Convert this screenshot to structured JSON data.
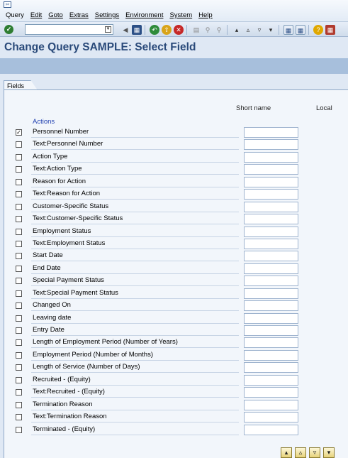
{
  "menubar": {
    "items": [
      "Query",
      "Edit",
      "Goto",
      "Extras",
      "Settings",
      "Environment",
      "System",
      "Help"
    ]
  },
  "toolbar": {
    "command_value": ""
  },
  "title": "Change Query SAMPLE: Select Field",
  "tab": {
    "label": "Fields"
  },
  "columns": {
    "short_name": "Short name",
    "local": "Local"
  },
  "group": {
    "label": "Actions"
  },
  "fields": [
    {
      "label": "Personnel Number",
      "checked": true
    },
    {
      "label": "Text:Personnel Number",
      "checked": false
    },
    {
      "label": "Action Type",
      "checked": false
    },
    {
      "label": "Text:Action Type",
      "checked": false
    },
    {
      "label": "Reason for Action",
      "checked": false
    },
    {
      "label": "Text:Reason for Action",
      "checked": false
    },
    {
      "label": "Customer-Specific Status",
      "checked": false
    },
    {
      "label": "Text:Customer-Specific Status",
      "checked": false
    },
    {
      "label": "Employment Status",
      "checked": false
    },
    {
      "label": "Text:Employment Status",
      "checked": false
    },
    {
      "label": "Start Date",
      "checked": false
    },
    {
      "label": "End Date",
      "checked": false
    },
    {
      "label": "Special Payment Status",
      "checked": false
    },
    {
      "label": "Text:Special Payment Status",
      "checked": false
    },
    {
      "label": "Changed On",
      "checked": false
    },
    {
      "label": "Leaving date",
      "checked": false
    },
    {
      "label": "Entry Date",
      "checked": false
    },
    {
      "label": "Length of Employment Period (Number of Years)",
      "checked": false
    },
    {
      "label": "Employment Period (Number of Months)",
      "checked": false
    },
    {
      "label": "Length of Service (Number of Days)",
      "checked": false
    },
    {
      "label": "Recruited - (Equity)",
      "checked": false
    },
    {
      "label": "Text:Recruited - (Equity)",
      "checked": false
    },
    {
      "label": "Termination Reason",
      "checked": false
    },
    {
      "label": "Text:Termination Reason",
      "checked": false
    },
    {
      "label": "Terminated - (Equity)",
      "checked": false
    }
  ],
  "icons": {
    "enter": "check-circle-icon",
    "save": "save-icon",
    "back": "back-icon",
    "exit": "exit-icon",
    "cancel": "cancel-icon",
    "print": "print-icon",
    "find": "find-icon",
    "help": "help-icon"
  },
  "colors": {
    "title": "#2a4a7a",
    "group_label": "#1f3fb0",
    "background": "#dfe8f4",
    "strip": "#a7bfdc"
  }
}
